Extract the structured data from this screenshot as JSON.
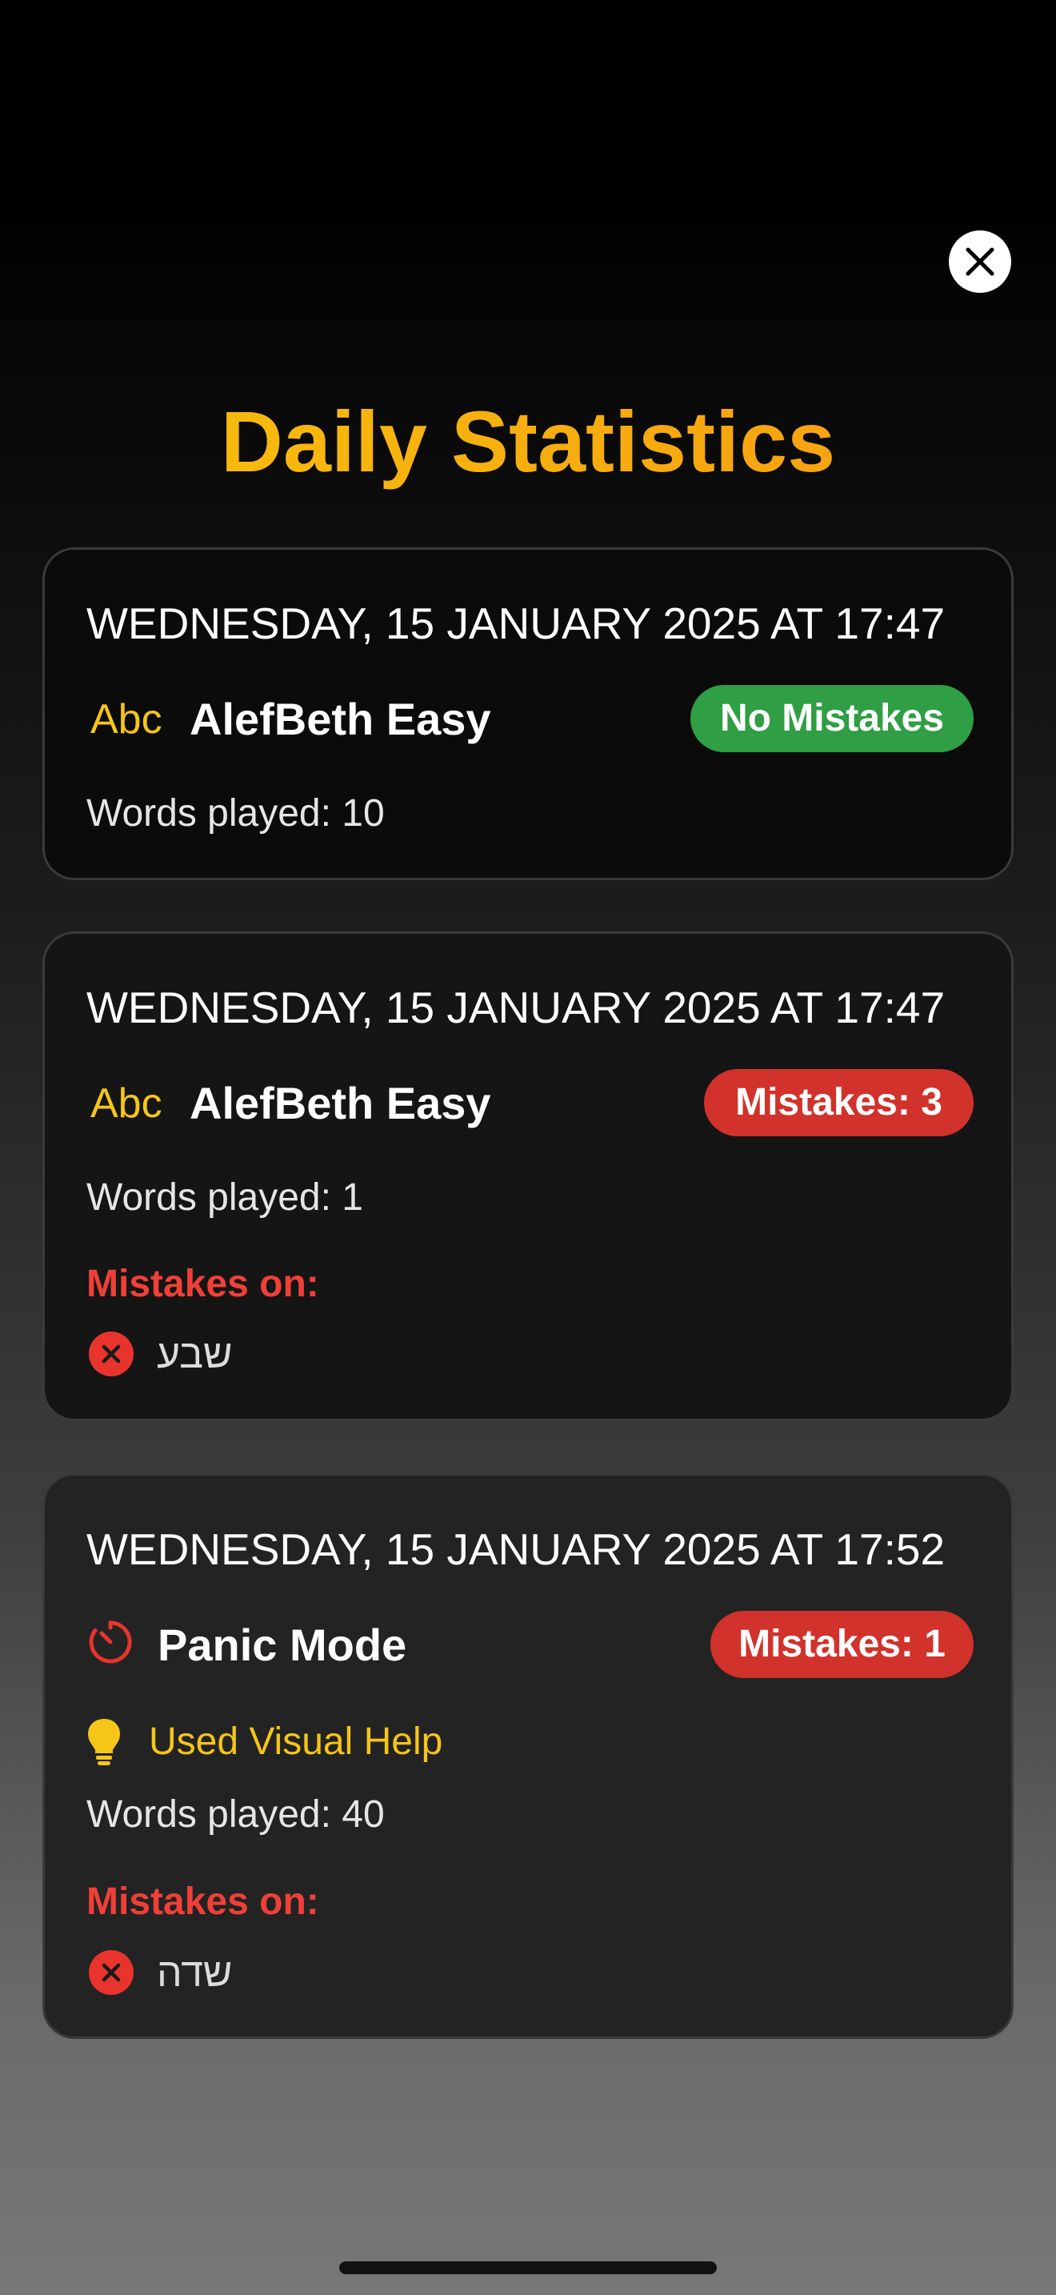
{
  "header": {
    "title": "Daily Statistics",
    "close_icon": "close-icon"
  },
  "sessions": [
    {
      "date": "WEDNESDAY, 15 JANUARY 2025 AT 17:47",
      "mode_icon": "abc-icon",
      "mode_icon_text": "Abc",
      "mode": "AlefBeth Easy",
      "badge": "No Mistakes",
      "badge_color": "#2f9e44",
      "words_played": "Words played: 10"
    },
    {
      "date": "WEDNESDAY, 15 JANUARY 2025 AT 17:47",
      "mode_icon": "abc-icon",
      "mode_icon_text": "Abc",
      "mode": "AlefBeth Easy",
      "badge": "Mistakes: 3",
      "badge_color": "#d1322b",
      "words_played": "Words played: 1",
      "mistakes_label": "Mistakes on:",
      "mistakes": [
        "שבע"
      ]
    },
    {
      "date": "WEDNESDAY, 15 JANUARY 2025 AT 17:52",
      "mode_icon": "timer-icon",
      "mode": "Panic Mode",
      "badge": "Mistakes: 1",
      "badge_color": "#d1322b",
      "visual_help": "Used Visual Help",
      "visual_help_icon": "lightbulb-icon",
      "words_played": "Words played: 40",
      "mistakes_label": "Mistakes on:",
      "mistakes": [
        "שדה"
      ]
    }
  ],
  "colors": {
    "accent_yellow": "#f5c518",
    "mistake_red": "#ef4038",
    "success_green": "#2f9e44"
  }
}
